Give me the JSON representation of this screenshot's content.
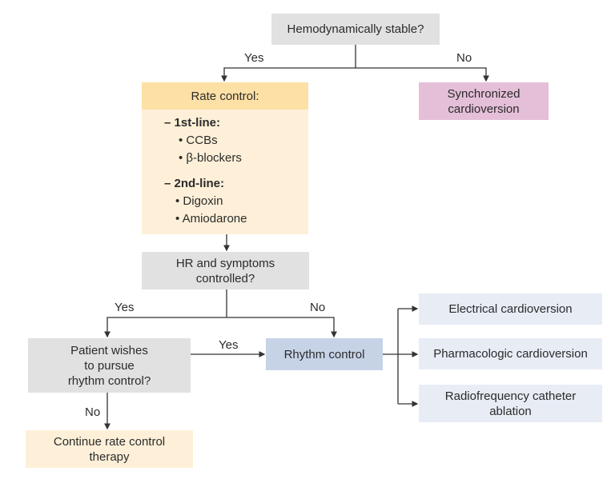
{
  "nodes": {
    "stable": "Hemodynamically stable?",
    "rate_control_title": "Rate control:",
    "synchronized": "Synchronized\ncardioversion",
    "hr_controlled": "HR and symptoms\ncontrolled?",
    "patient_wishes": "Patient wishes\nto pursue\nrhythm control?",
    "rhythm_control": "Rhythm control",
    "continue_rate": "Continue rate control\ntherapy",
    "electrical": "Electrical cardioversion",
    "pharmacologic": "Pharmacologic cardioversion",
    "radiofrequency": "Radiofrequency catheter\nablation"
  },
  "rate_control_list": {
    "first_line_label": "– 1st-line:",
    "first_line_items": [
      "• CCBs",
      "• β-blockers"
    ],
    "second_line_label": "– 2nd-line:",
    "second_line_items": [
      "• Digoxin",
      "• Amiodarone"
    ]
  },
  "edge_labels": {
    "stable_yes": "Yes",
    "stable_no": "No",
    "hr_yes": "Yes",
    "hr_no": "No",
    "wishes_yes": "Yes",
    "wishes_no": "No"
  }
}
